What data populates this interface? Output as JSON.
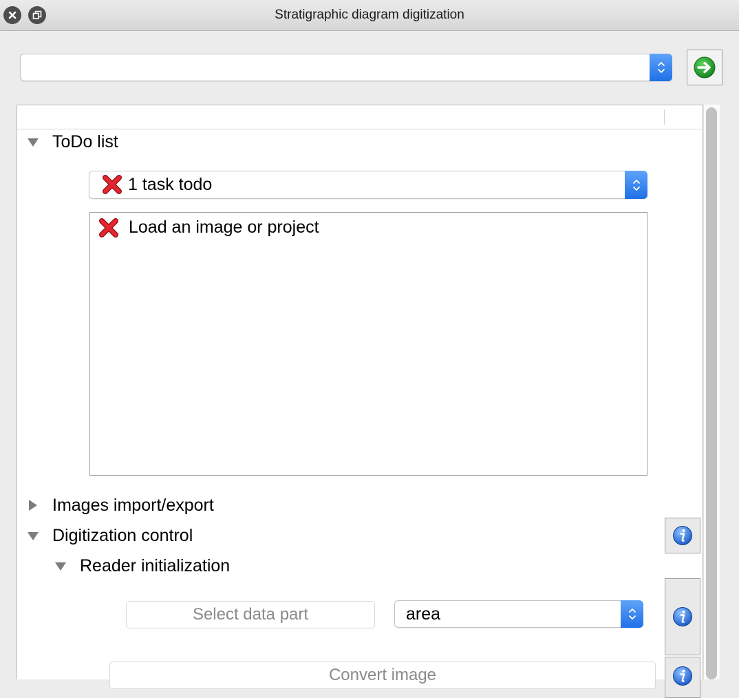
{
  "window": {
    "title": "Stratigraphic diagram digitization"
  },
  "toolbar": {
    "combo_value": ""
  },
  "todo": {
    "section_label": "ToDo list",
    "summary": "1 task todo",
    "tasks": [
      "Load an image or project"
    ]
  },
  "sections": {
    "images": "Images import/export",
    "digitization": "Digitization control",
    "reader": "Reader initialization"
  },
  "reader": {
    "select_button": "Select data part",
    "data_part_value": "area",
    "convert_button": "Convert image"
  },
  "colors": {
    "accent_blue": "#1f6fe8",
    "go_green": "#1c9a2a",
    "error_red": "#d8202a"
  }
}
